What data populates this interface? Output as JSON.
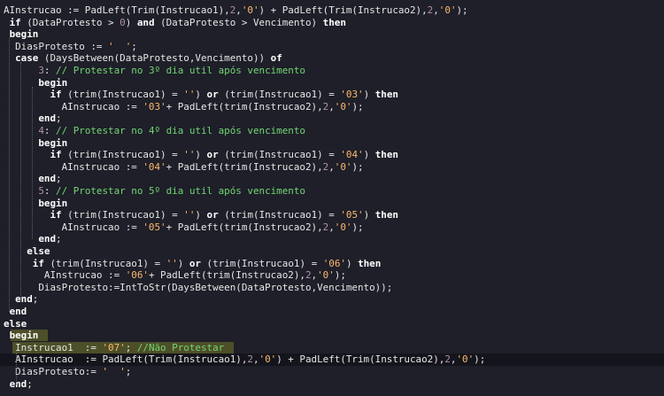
{
  "editor": {
    "lines": [
      [
        {
          "t": "AInstrucao := PadLeft(Trim(Instrucao1),",
          "c": "id"
        },
        {
          "t": "2",
          "c": "num"
        },
        {
          "t": ",",
          "c": "id"
        },
        {
          "t": "'0'",
          "c": "str"
        },
        {
          "t": ") + PadLeft(Trim(Instrucao2),",
          "c": "id"
        },
        {
          "t": "2",
          "c": "num"
        },
        {
          "t": ",",
          "c": "id"
        },
        {
          "t": "'0'",
          "c": "str"
        },
        {
          "t": ");",
          "c": "id"
        }
      ],
      [
        {
          "t": " ",
          "c": "id"
        },
        {
          "t": "if",
          "c": "kw"
        },
        {
          "t": " (DataProtesto > ",
          "c": "id"
        },
        {
          "t": "0",
          "c": "num"
        },
        {
          "t": ") ",
          "c": "id"
        },
        {
          "t": "and",
          "c": "kw"
        },
        {
          "t": " (DataProtesto > Vencimento) ",
          "c": "id"
        },
        {
          "t": "then",
          "c": "kw"
        }
      ],
      [
        {
          "t": " ",
          "c": "id"
        },
        {
          "t": "begin",
          "c": "kw"
        }
      ],
      [
        {
          "t": "  DiasProtesto := ",
          "c": "id"
        },
        {
          "t": "'  '",
          "c": "str"
        },
        {
          "t": ";",
          "c": "id"
        }
      ],
      [
        {
          "t": "  ",
          "c": "id"
        },
        {
          "t": "case",
          "c": "kw"
        },
        {
          "t": " (DaysBetween(DataProtesto,Vencimento)) ",
          "c": "id"
        },
        {
          "t": "of",
          "c": "kw"
        }
      ],
      [
        {
          "t": "      ",
          "c": "id"
        },
        {
          "t": "3",
          "c": "num"
        },
        {
          "t": ": ",
          "c": "id"
        },
        {
          "t": "// Protestar no 3º dia util após vencimento",
          "c": "cmt"
        }
      ],
      [
        {
          "t": "      ",
          "c": "id"
        },
        {
          "t": "begin",
          "c": "kw"
        }
      ],
      [
        {
          "t": "        ",
          "c": "id"
        },
        {
          "t": "if",
          "c": "kw"
        },
        {
          "t": " (trim(Instrucao1) = ",
          "c": "id"
        },
        {
          "t": "''",
          "c": "str"
        },
        {
          "t": ") ",
          "c": "id"
        },
        {
          "t": "or",
          "c": "kw"
        },
        {
          "t": " (trim(Instrucao1) = ",
          "c": "id"
        },
        {
          "t": "'03'",
          "c": "str"
        },
        {
          "t": ") ",
          "c": "id"
        },
        {
          "t": "then",
          "c": "kw"
        }
      ],
      [
        {
          "t": "          AInstrucao := ",
          "c": "id"
        },
        {
          "t": "'03'",
          "c": "str"
        },
        {
          "t": "+ PadLeft(trim(Instrucao2),",
          "c": "id"
        },
        {
          "t": "2",
          "c": "num"
        },
        {
          "t": ",",
          "c": "id"
        },
        {
          "t": "'0'",
          "c": "str"
        },
        {
          "t": ");",
          "c": "id"
        }
      ],
      [
        {
          "t": "      ",
          "c": "id"
        },
        {
          "t": "end",
          "c": "kw"
        },
        {
          "t": ";",
          "c": "id"
        }
      ],
      [
        {
          "t": "      ",
          "c": "id"
        },
        {
          "t": "4",
          "c": "num"
        },
        {
          "t": ": ",
          "c": "id"
        },
        {
          "t": "// Protestar no 4º dia util após vencimento",
          "c": "cmt"
        }
      ],
      [
        {
          "t": "      ",
          "c": "id"
        },
        {
          "t": "begin",
          "c": "kw"
        }
      ],
      [
        {
          "t": "        ",
          "c": "id"
        },
        {
          "t": "if",
          "c": "kw"
        },
        {
          "t": " (trim(Instrucao1) = ",
          "c": "id"
        },
        {
          "t": "''",
          "c": "str"
        },
        {
          "t": ") ",
          "c": "id"
        },
        {
          "t": "or",
          "c": "kw"
        },
        {
          "t": " (trim(Instrucao1) = ",
          "c": "id"
        },
        {
          "t": "'04'",
          "c": "str"
        },
        {
          "t": ") ",
          "c": "id"
        },
        {
          "t": "then",
          "c": "kw"
        }
      ],
      [
        {
          "t": "          AInstrucao := ",
          "c": "id"
        },
        {
          "t": "'04'",
          "c": "str"
        },
        {
          "t": "+ PadLeft(trim(Instrucao2),",
          "c": "id"
        },
        {
          "t": "2",
          "c": "num"
        },
        {
          "t": ",",
          "c": "id"
        },
        {
          "t": "'0'",
          "c": "str"
        },
        {
          "t": ");",
          "c": "id"
        }
      ],
      [
        {
          "t": "      ",
          "c": "id"
        },
        {
          "t": "end",
          "c": "kw"
        },
        {
          "t": ";",
          "c": "id"
        }
      ],
      [
        {
          "t": "      ",
          "c": "id"
        },
        {
          "t": "5",
          "c": "num"
        },
        {
          "t": ": ",
          "c": "id"
        },
        {
          "t": "// Protestar no 5º dia util após vencimento",
          "c": "cmt"
        }
      ],
      [
        {
          "t": "      ",
          "c": "id"
        },
        {
          "t": "begin",
          "c": "kw"
        }
      ],
      [
        {
          "t": "        ",
          "c": "id"
        },
        {
          "t": "if",
          "c": "kw"
        },
        {
          "t": " (trim(Instrucao1) = ",
          "c": "id"
        },
        {
          "t": "''",
          "c": "str"
        },
        {
          "t": ") ",
          "c": "id"
        },
        {
          "t": "or",
          "c": "kw"
        },
        {
          "t": " (trim(Instrucao1) = ",
          "c": "id"
        },
        {
          "t": "'05'",
          "c": "str"
        },
        {
          "t": ") ",
          "c": "id"
        },
        {
          "t": "then",
          "c": "kw"
        }
      ],
      [
        {
          "t": "          AInstrucao := ",
          "c": "id"
        },
        {
          "t": "'05'",
          "c": "str"
        },
        {
          "t": "+ PadLeft(trim(Instrucao2),",
          "c": "id"
        },
        {
          "t": "2",
          "c": "num"
        },
        {
          "t": ",",
          "c": "id"
        },
        {
          "t": "'0'",
          "c": "str"
        },
        {
          "t": ");",
          "c": "id"
        }
      ],
      [
        {
          "t": "      ",
          "c": "id"
        },
        {
          "t": "end",
          "c": "kw"
        },
        {
          "t": ";",
          "c": "id"
        }
      ],
      [
        {
          "t": "    ",
          "c": "id"
        },
        {
          "t": "else",
          "c": "kw"
        }
      ],
      [
        {
          "t": "     ",
          "c": "id"
        },
        {
          "t": "if",
          "c": "kw"
        },
        {
          "t": " (trim(Instrucao1) = ",
          "c": "id"
        },
        {
          "t": "''",
          "c": "str"
        },
        {
          "t": ") ",
          "c": "id"
        },
        {
          "t": "or",
          "c": "kw"
        },
        {
          "t": " (trim(Instrucao1) = ",
          "c": "id"
        },
        {
          "t": "'06'",
          "c": "str"
        },
        {
          "t": ") ",
          "c": "id"
        },
        {
          "t": "then",
          "c": "kw"
        }
      ],
      [
        {
          "t": "       AInstrucao := ",
          "c": "id"
        },
        {
          "t": "'06'",
          "c": "str"
        },
        {
          "t": "+ PadLeft(trim(Instrucao2),",
          "c": "id"
        },
        {
          "t": "2",
          "c": "num"
        },
        {
          "t": ",",
          "c": "id"
        },
        {
          "t": "'0'",
          "c": "str"
        },
        {
          "t": ");",
          "c": "id"
        }
      ],
      [
        {
          "t": "      DiasProtesto:=IntToStr(DaysBetween(DataProtesto,Vencimento));",
          "c": "id"
        }
      ],
      [
        {
          "t": "  ",
          "c": "id"
        },
        {
          "t": "end",
          "c": "kw"
        },
        {
          "t": ";",
          "c": "id"
        }
      ],
      [
        {
          "t": " ",
          "c": "id"
        },
        {
          "t": "end",
          "c": "kw"
        }
      ],
      [
        {
          "t": "else",
          "c": "kw"
        }
      ],
      [
        {
          "t": " ",
          "c": "id"
        },
        {
          "t": "begin",
          "c": "kw"
        }
      ],
      [
        {
          "t": "  Instrucao1  := ",
          "c": "id"
        },
        {
          "t": "'07'",
          "c": "str"
        },
        {
          "t": "; ",
          "c": "id"
        },
        {
          "t": "//Não Protestar",
          "c": "cmt"
        }
      ],
      [
        {
          "t": "  AInstrucao  := PadLeft(Trim(Instrucao1),",
          "c": "id"
        },
        {
          "t": "2",
          "c": "num"
        },
        {
          "t": ",",
          "c": "id"
        },
        {
          "t": "'0'",
          "c": "str"
        },
        {
          "t": ") + PadLeft(Trim(Instrucao2),",
          "c": "id"
        },
        {
          "t": "2",
          "c": "num"
        },
        {
          "t": ",",
          "c": "id"
        },
        {
          "t": "'0'",
          "c": "str"
        },
        {
          "t": ");",
          "c": "id"
        }
      ],
      [
        {
          "t": "  DiasProtesto:= ",
          "c": "id"
        },
        {
          "t": "'  '",
          "c": "str"
        },
        {
          "t": ";",
          "c": "id"
        }
      ],
      [
        {
          "t": " ",
          "c": "id"
        },
        {
          "t": "end",
          "c": "kw"
        },
        {
          "t": ";",
          "c": "id"
        }
      ]
    ],
    "current_line": 29,
    "highlighted_lines": [
      27,
      28,
      29
    ],
    "colors": {
      "background": "#1e1f29",
      "keyword": "#ffffff",
      "string": "#ffb86c",
      "number": "#b48ead",
      "comment": "#72d572",
      "highlight": "#c8cd28"
    }
  }
}
